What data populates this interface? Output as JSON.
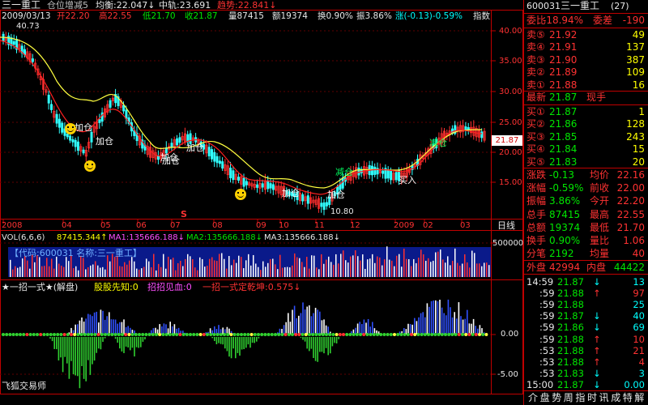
{
  "header": {
    "stock_name": "三一重工",
    "info_label": "仓位增减5",
    "avg_label": "均衡:22.047↓",
    "mid_label": "中轨:23.691",
    "trend_label": "趋势:22.841↓",
    "date": "2009/03/13",
    "open": "开22.20",
    "high": "高22.55",
    "low": "低21.70",
    "close": "收21.87",
    "volume": "量87415",
    "amount": "额19374",
    "turnover": "换0.90%",
    "amplitude": "振3.86%",
    "change": "涨(-0.13)-0.59%",
    "index_label": "指数"
  },
  "main_chart": {
    "price_max_label": "40.73",
    "price_min_label": "10.80",
    "current_price_tag": "21.87",
    "y_ticks": [
      "40.00",
      "35.00",
      "30.00",
      "25.00",
      "20.00",
      "15.00"
    ],
    "x_ticks": [
      "2008",
      "04",
      "05",
      "06",
      "07",
      "08",
      "09",
      "10",
      "11",
      "12",
      "2009",
      "02",
      "03"
    ],
    "period_label": "日线",
    "s_marker": "S",
    "annotations": [
      {
        "text": "加仓",
        "kind": "add"
      },
      {
        "text": "加仓",
        "kind": "add"
      },
      {
        "text": "加仓",
        "kind": "add"
      },
      {
        "text": "加仓",
        "kind": "add"
      },
      {
        "text": "加仓",
        "kind": "add"
      },
      {
        "text": "加仓",
        "kind": "add"
      },
      {
        "text": "加仓",
        "kind": "add"
      },
      {
        "text": "减仓",
        "kind": "reduce"
      },
      {
        "text": "减仓",
        "kind": "reduce"
      },
      {
        "text": "买入",
        "kind": "buy"
      }
    ]
  },
  "volume_panel": {
    "title": "VOL(6,6,6)",
    "vol_value": "87415.344↑",
    "ma1": "MA1:135666.188↓",
    "ma2": "MA2:135666.188↓",
    "ma3": "MA3:135666.188↓",
    "y_tick": "500000",
    "code_box": "【代码:600031 名称:三一重工】"
  },
  "indicator_panel": {
    "title": "★一招一式★(解盘)",
    "item1": "股股先知:0",
    "item2": "招招见血:0",
    "item3": "一招一式定乾坤:0.575↓",
    "y_ticks": [
      "0.00",
      "-5.00"
    ],
    "watermark": "飞狐交易师"
  },
  "right_panel": {
    "code": "600031",
    "name": "三一重工",
    "count": "(27)",
    "weibi_label": "委比",
    "weibi_value": "-18.94%",
    "weicha_label": "委差",
    "weicha_value": "-190",
    "sells": [
      {
        "label": "卖⑤",
        "price": "21.92",
        "vol": "49"
      },
      {
        "label": "卖④",
        "price": "21.91",
        "vol": "137"
      },
      {
        "label": "卖③",
        "price": "21.90",
        "vol": "387"
      },
      {
        "label": "卖②",
        "price": "21.89",
        "vol": "109"
      },
      {
        "label": "卖①",
        "price": "21.88",
        "vol": "16"
      }
    ],
    "latest_label": "最新",
    "latest_value": "21.87",
    "now_hand_label": "现手",
    "buys": [
      {
        "label": "买①",
        "price": "21.87",
        "vol": "1"
      },
      {
        "label": "买②",
        "price": "21.86",
        "vol": "128"
      },
      {
        "label": "买③",
        "price": "21.85",
        "vol": "243"
      },
      {
        "label": "买④",
        "price": "21.84",
        "vol": "15"
      },
      {
        "label": "买⑤",
        "price": "21.83",
        "vol": "20"
      }
    ],
    "stats": [
      {
        "l1": "涨跌",
        "v1": "-0.13",
        "l2": "均价",
        "v2": "22.16"
      },
      {
        "l1": "涨幅",
        "v1": "-0.59%",
        "l2": "前收",
        "v2": "22.00"
      },
      {
        "l1": "振幅",
        "v1": "3.86%",
        "l2": "今开",
        "v2": "22.20"
      },
      {
        "l1": "总手",
        "v1": "87415",
        "l2": "最高",
        "v2": "22.55"
      },
      {
        "l1": "总额",
        "v1": "19374",
        "l2": "最低",
        "v2": "21.70"
      },
      {
        "l1": "换手",
        "v1": "0.90%",
        "l2": "量比",
        "v2": "1.06"
      },
      {
        "l1": "分笔",
        "v1": "2192",
        "l2": "均量",
        "v2": "40"
      }
    ],
    "outer_label": "外盘",
    "outer_value": "42994",
    "inner_label": "内盘",
    "inner_value": "44422",
    "ticks": [
      {
        "time": "14:59",
        "price": "21.87",
        "arrow": "↓",
        "vol": "13"
      },
      {
        "time": ":59",
        "price": "21.88",
        "arrow": "↑",
        "vol": "97"
      },
      {
        "time": ":59",
        "price": "21.88",
        "arrow": "",
        "vol": "25"
      },
      {
        "time": ":59",
        "price": "21.87",
        "arrow": "↓",
        "vol": "40"
      },
      {
        "time": ":59",
        "price": "21.86",
        "arrow": "↓",
        "vol": "69"
      },
      {
        "time": ":59",
        "price": "21.88",
        "arrow": "↑",
        "vol": "10"
      },
      {
        "time": ":53",
        "price": "21.88",
        "arrow": "↑",
        "vol": "21"
      },
      {
        "time": ":53",
        "price": "21.88",
        "arrow": "↑",
        "vol": "4"
      },
      {
        "time": ":53",
        "price": "21.83",
        "arrow": "↓",
        "vol": "3"
      },
      {
        "time": "15:00",
        "price": "21.87",
        "arrow": "↓",
        "vol": "0.00"
      }
    ],
    "footer_tabs": [
      "介",
      "盘",
      "势",
      "周",
      "指",
      "时",
      "讯",
      "成",
      "特",
      "解"
    ]
  }
}
